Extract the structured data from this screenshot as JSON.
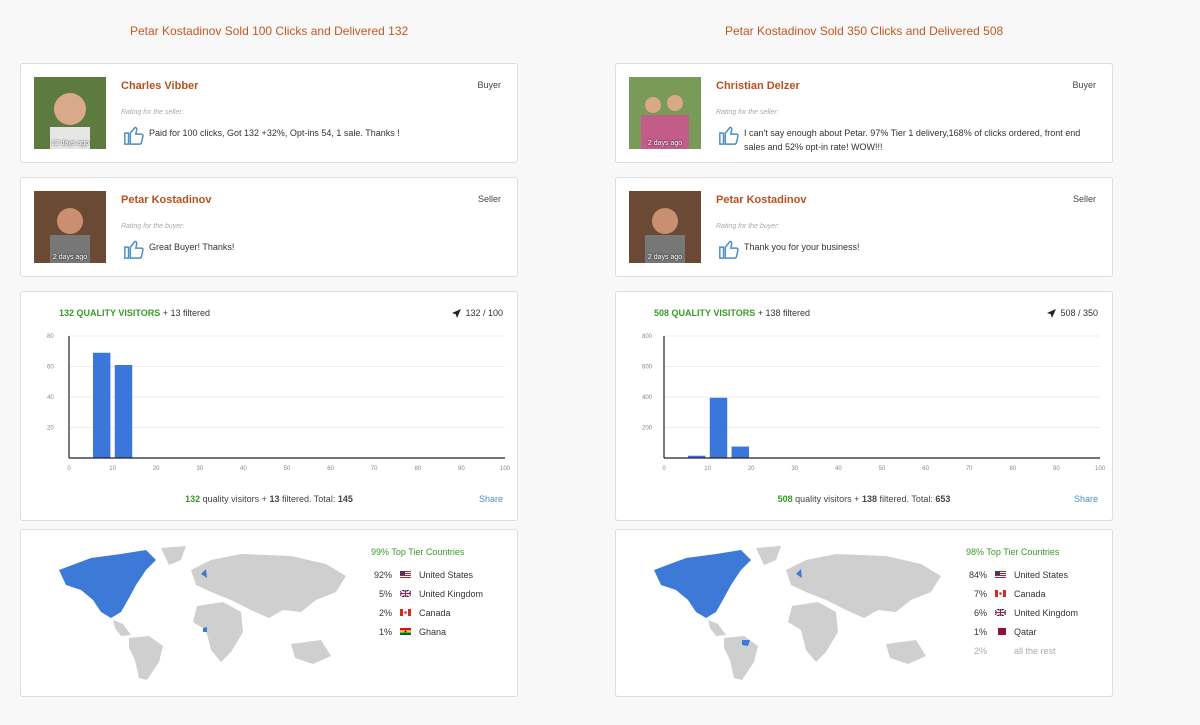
{
  "panels": [
    {
      "title": "Petar Kostadinov Sold 100 Clicks and Delivered 132",
      "reviews": [
        {
          "name": "Charles Vibber",
          "role": "Buyer",
          "label": "Rating for the seller:",
          "text": [
            "Paid for 100 clicks, Got 132 +32%, Opt-ins 54, 1 sale. Thanks !"
          ],
          "days": "12 days ago"
        },
        {
          "name": "Petar Kostadinov",
          "role": "Seller",
          "label": "Rating for the buyer:",
          "text": [
            "Great Buyer! Thanks!"
          ],
          "days": "2 days ago"
        }
      ],
      "visitors": {
        "quality": "132 QUALITY VISITORS",
        "filtered": "+ 13 filtered",
        "ratio": "132 / 100",
        "total_quality": "132",
        "total_filtered": "13",
        "total": "145",
        "share": "Share"
      },
      "chart_data": {
        "type": "bar",
        "x": [
          7.5,
          12.5
        ],
        "values": [
          69,
          61
        ],
        "xlim": [
          0,
          100
        ],
        "ylim": [
          0,
          80
        ],
        "xticks": [
          "0",
          "10",
          "20",
          "30",
          "40",
          "50",
          "60",
          "70",
          "80",
          "90",
          "100"
        ],
        "yticks": [
          "20",
          "40",
          "60",
          "80"
        ],
        "color": "#3b77db"
      },
      "tier": "99% Top Tier Countries",
      "countries": [
        {
          "pct": "92%",
          "name": "United States",
          "flag": "us"
        },
        {
          "pct": "5%",
          "name": "United Kingdom",
          "flag": "uk"
        },
        {
          "pct": "2%",
          "name": "Canada",
          "flag": "ca"
        },
        {
          "pct": "1%",
          "name": "Ghana",
          "flag": "gh"
        }
      ]
    },
    {
      "title": "Petar Kostadinov Sold 350 Clicks and Delivered 508",
      "reviews": [
        {
          "name": "Christian Delzer",
          "role": "Buyer",
          "label": "Rating for the seller:",
          "text": [
            "I can't say enough about Petar. 97% Tier 1 delivery,168% of clicks ordered, front end",
            "sales and 52% opt-in rate! WOW!!!"
          ],
          "days": "2 days ago"
        },
        {
          "name": "Petar Kostadinov",
          "role": "Seller",
          "label": "Rating for the buyer:",
          "text": [
            "Thank you for your business!"
          ],
          "days": "2 days ago"
        }
      ],
      "visitors": {
        "quality": "508 QUALITY VISITORS",
        "filtered": "+ 138 filtered",
        "ratio": "508 / 350",
        "total_quality": "508",
        "total_filtered": "138",
        "total": "653",
        "share": "Share"
      },
      "chart_data": {
        "type": "bar",
        "x": [
          7.5,
          12.5,
          17.5
        ],
        "values": [
          15,
          395,
          75
        ],
        "xlim": [
          0,
          100
        ],
        "ylim": [
          0,
          800
        ],
        "xticks": [
          "0",
          "10",
          "20",
          "30",
          "40",
          "50",
          "60",
          "70",
          "80",
          "90",
          "100"
        ],
        "yticks": [
          "200",
          "400",
          "600",
          "800"
        ],
        "color": "#3b77db"
      },
      "tier": "98% Top Tier Countries",
      "countries": [
        {
          "pct": "84%",
          "name": "United States",
          "flag": "us"
        },
        {
          "pct": "7%",
          "name": "Canada",
          "flag": "ca"
        },
        {
          "pct": "6%",
          "name": "United Kingdom",
          "flag": "uk"
        },
        {
          "pct": "1%",
          "name": "Qatar",
          "flag": "qa"
        },
        {
          "pct": "2%",
          "name": "all the rest",
          "flag": "",
          "muted": true
        }
      ]
    }
  ]
}
